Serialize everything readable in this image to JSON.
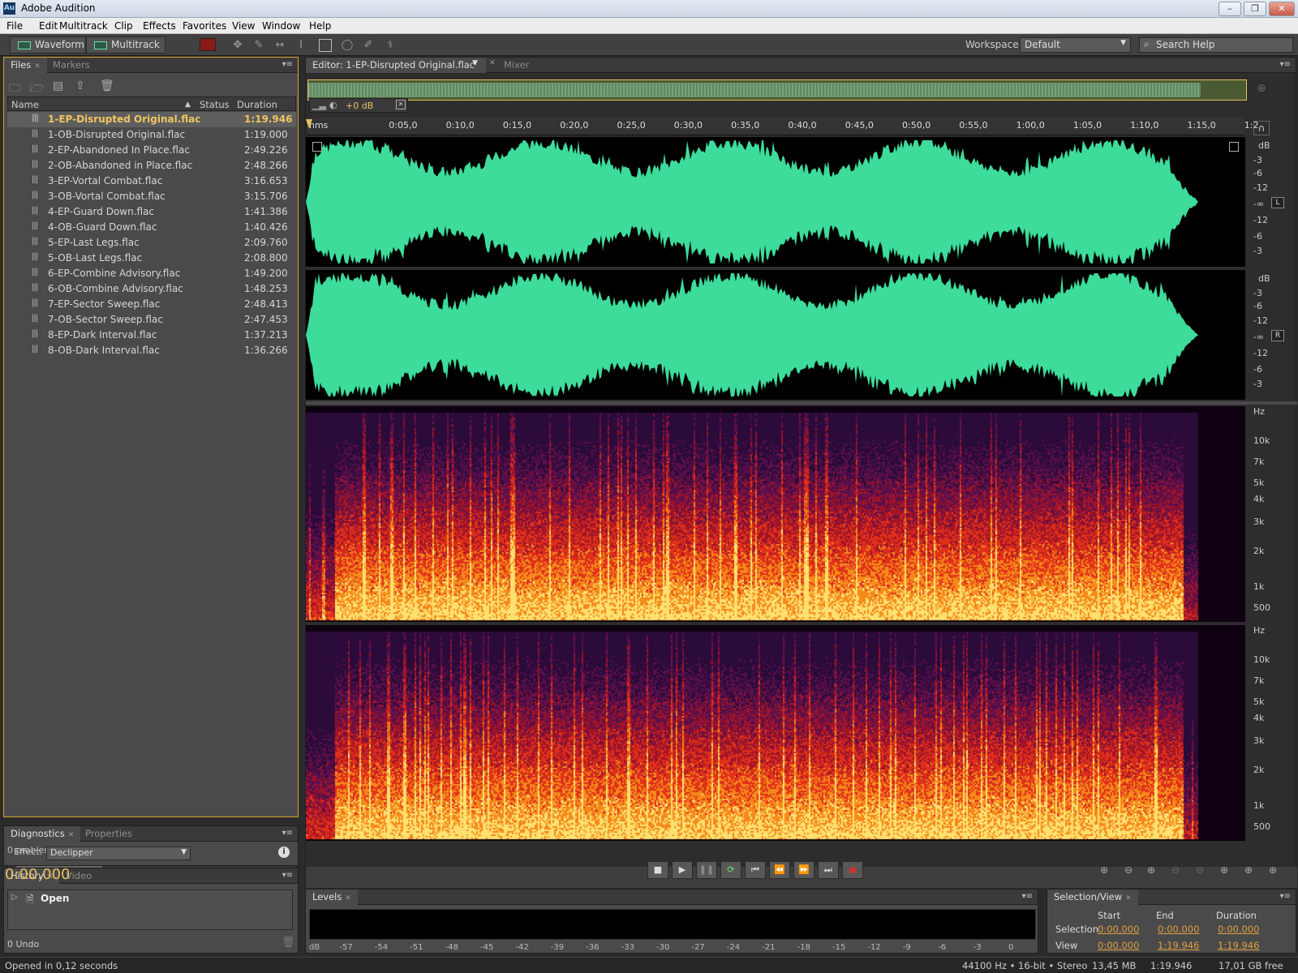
{
  "window": {
    "title": "Adobe Audition",
    "icon_text": "Au"
  },
  "menu": [
    "File",
    "Edit",
    "Multitrack",
    "Clip",
    "Effects",
    "Favorites",
    "View",
    "Window",
    "Help"
  ],
  "toolbar": {
    "waveform_label": "Waveform",
    "multitrack_label": "Multitrack",
    "workspace_label": "Workspace:",
    "workspace_value": "Default",
    "search_placeholder": "Search Help"
  },
  "files_panel": {
    "tabs": [
      "Files",
      "Markers"
    ],
    "columns": {
      "name": "Name",
      "status": "Status",
      "duration": "Duration"
    },
    "items": [
      {
        "name": "1-EP-Disrupted Original.flac",
        "duration": "1:19.946",
        "selected": true
      },
      {
        "name": "1-OB-Disrupted Original.flac",
        "duration": "1:19.000"
      },
      {
        "name": "2-EP-Abandoned In Place.flac",
        "duration": "2:49.226"
      },
      {
        "name": "2-OB-Abandoned in Place.flac",
        "duration": "2:48.266"
      },
      {
        "name": "3-EP-Vortal Combat.flac",
        "duration": "3:16.653"
      },
      {
        "name": "3-OB-Vortal Combat.flac",
        "duration": "3:15.706"
      },
      {
        "name": "4-EP-Guard Down.flac",
        "duration": "1:41.386"
      },
      {
        "name": "4-OB-Guard Down.flac",
        "duration": "1:40.426"
      },
      {
        "name": "5-EP-Last Legs.flac",
        "duration": "2:09.760"
      },
      {
        "name": "5-OB-Last Legs.flac",
        "duration": "2:08.800"
      },
      {
        "name": "6-EP-Combine Advisory.flac",
        "duration": "1:49.200"
      },
      {
        "name": "6-OB-Combine Advisory.flac",
        "duration": "1:48.253"
      },
      {
        "name": "7-EP-Sector Sweep.flac",
        "duration": "2:48.413"
      },
      {
        "name": "7-OB-Sector Sweep.flac",
        "duration": "2:47.453"
      },
      {
        "name": "8-EP-Dark Interval.flac",
        "duration": "1:37.213"
      },
      {
        "name": "8-OB-Dark Interval.flac",
        "duration": "1:36.266"
      }
    ]
  },
  "diagnostics_panel": {
    "tabs": [
      "Diagnostics",
      "Properties"
    ],
    "effect_label": "Effect:",
    "effect_value": "Declipper",
    "status": "0 problems detected."
  },
  "history_panel": {
    "tabs": [
      "History",
      "Video"
    ],
    "items": [
      "Open"
    ],
    "undo_count": "0 Undo"
  },
  "editor": {
    "tab_label": "Editor: 1-EP-Disrupted Original.flac",
    "mixer_label": "Mixer",
    "hud_gain": "+0 dB",
    "ruler_ticks": [
      "hms",
      "0:05,0",
      "0:10,0",
      "0:15,0",
      "0:20,0",
      "0:25,0",
      "0:30,0",
      "0:35,0",
      "0:40,0",
      "0:45,0",
      "0:50,0",
      "0:55,0",
      "1:00,0",
      "1:05,0",
      "1:10,0",
      "1:15,0",
      "1:2"
    ],
    "db_scale": [
      "dB",
      "-3",
      "-6",
      "-12",
      "-∞",
      "-12",
      "-6",
      "-3"
    ],
    "channels": [
      "L",
      "R"
    ],
    "hz_scale": [
      "Hz",
      "10k",
      "7k",
      "5k",
      "4k",
      "3k",
      "2k",
      "1k",
      "500"
    ],
    "colors": {
      "waveform": "#3ddc9b",
      "background": "#000000",
      "accent": "#e8c060"
    }
  },
  "transport": {
    "timecode": "0:00.000",
    "buttons": [
      "stop",
      "play",
      "pause",
      "loop",
      "go-to-start",
      "rewind",
      "fast-forward",
      "go-to-end",
      "record"
    ]
  },
  "levels_panel": {
    "tab": "Levels",
    "scale": [
      "dB",
      "-57",
      "-54",
      "-51",
      "-48",
      "-45",
      "-42",
      "-39",
      "-36",
      "-33",
      "-30",
      "-27",
      "-24",
      "-21",
      "-18",
      "-15",
      "-12",
      "-9",
      "-6",
      "-3",
      "0"
    ]
  },
  "selection_view_panel": {
    "tab": "Selection/View",
    "headers": [
      "Start",
      "End",
      "Duration"
    ],
    "rows": [
      {
        "label": "Selection",
        "start": "0:00.000",
        "end": "0:00.000",
        "duration": "0:00.000"
      },
      {
        "label": "View",
        "start": "0:00.000",
        "end": "1:19.946",
        "duration": "1:19.946"
      }
    ]
  },
  "status_bar": {
    "left": "Opened in 0,12 seconds",
    "sample": "44100 Hz • 16-bit • Stereo",
    "size": "13,45 MB",
    "duration": "1:19.946",
    "free": "17,01 GB free"
  }
}
